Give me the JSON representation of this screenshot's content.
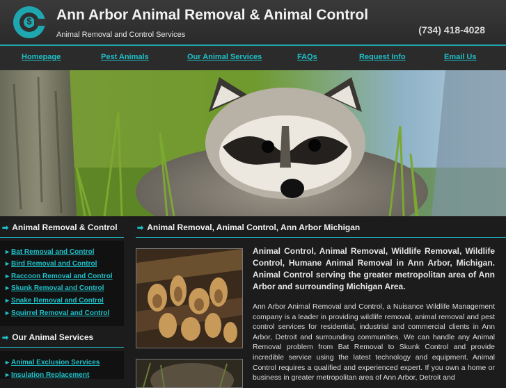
{
  "header": {
    "title": "Ann Arbor Animal Removal & Animal Control",
    "tagline": "Animal Removal and Control Services",
    "phone": "(734) 418-4028",
    "logo_glyph": "$"
  },
  "nav": {
    "items": [
      {
        "label": "Homepage"
      },
      {
        "label": "Pest Animals"
      },
      {
        "label": "Our Animal Services"
      },
      {
        "label": "FAQs"
      },
      {
        "label": "Request Info"
      },
      {
        "label": "Email Us"
      }
    ]
  },
  "sidebar": {
    "section1": {
      "heading": "Animal Removal & Control",
      "items": [
        {
          "label": "Bat Removal and Control"
        },
        {
          "label": "Bird Removal and Control"
        },
        {
          "label": "Raccoon Removal and Control"
        },
        {
          "label": "Skunk Removal and Control"
        },
        {
          "label": "Snake Removal and Control"
        },
        {
          "label": "Squirrel Removal and Control"
        }
      ]
    },
    "section2": {
      "heading": "Our Animal Services",
      "items": [
        {
          "label": "Animal Exclusion Services"
        },
        {
          "label": "Insulation Replacement"
        }
      ]
    }
  },
  "main": {
    "heading": "Animal Removal, Animal Control, Ann Arbor Michigan",
    "lead": "Animal Control, Animal Removal, Wildlife Removal, Wildlife Control, Humane Animal Removal in Ann Arbor, Michigan. Animal Control serving the greater metropolitan area of Ann Arbor and surrounding Michigan Area.",
    "body": "Ann Arbor Animal Removal and Control, a Nuisance Wildlife Management company is a leader in providing wildlife removal, animal removal and pest control services for residential, industrial and commercial clients in Ann Arbor, Detroit and surrounding communities. We can handle any Animal Removal problem from Bat Removal to Skunk Control and provide incredible service using the latest technology and equipment. Animal Control requires a qualified and experienced expert. If you own a home or business in greater metropolitan area of Ann Arbor, Detroit and"
  },
  "icons": {
    "heading_arrow": "➡",
    "bullet": "▸"
  },
  "colors": {
    "accent": "#1fa7b0",
    "link": "#1fc0c8",
    "background": "#1c1c1c"
  }
}
